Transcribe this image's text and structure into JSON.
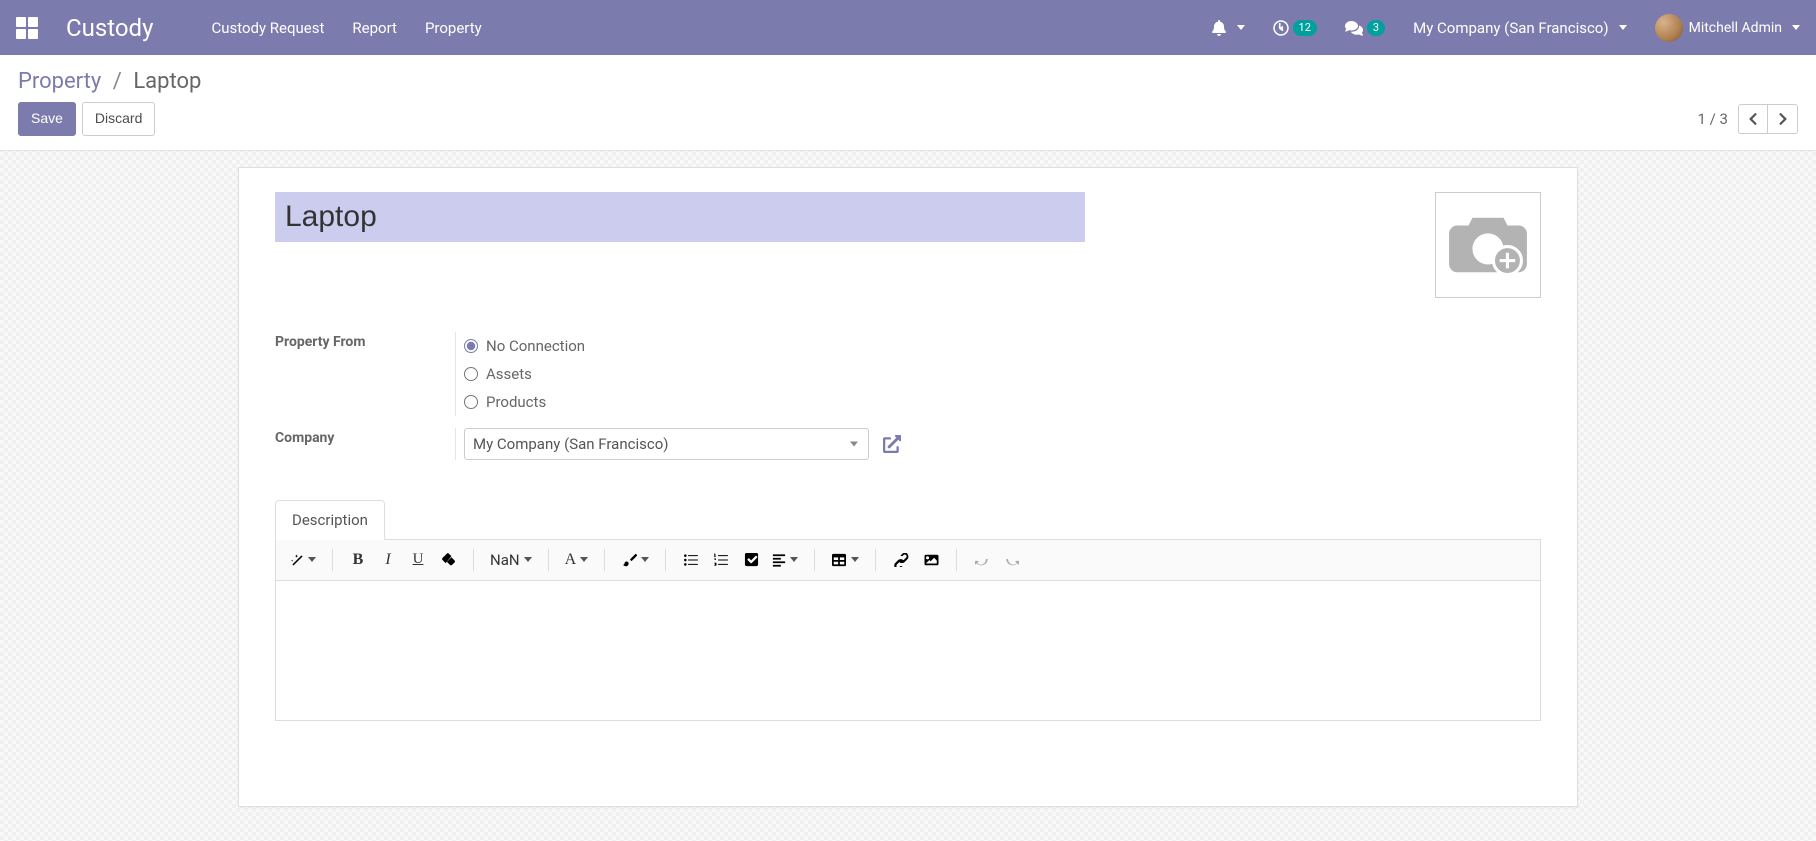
{
  "app_title": "Custody",
  "nav": {
    "items": [
      "Custody Request",
      "Report",
      "Property"
    ]
  },
  "systray": {
    "activities_count": "12",
    "messages_count": "3",
    "company": "My Company (San Francisco)",
    "user": "Mitchell Admin"
  },
  "breadcrumb": {
    "parent": "Property",
    "current": "Laptop"
  },
  "buttons": {
    "save": "Save",
    "discard": "Discard"
  },
  "pager": {
    "text": "1 / 3"
  },
  "form": {
    "title_value": "Laptop",
    "property_from_label": "Property From",
    "property_from_options": {
      "no_connection": "No Connection",
      "assets": "Assets",
      "products": "Products"
    },
    "company_label": "Company",
    "company_value": "My Company (San Francisco)",
    "tab_description": "Description",
    "rte_font_size": "NaN"
  }
}
